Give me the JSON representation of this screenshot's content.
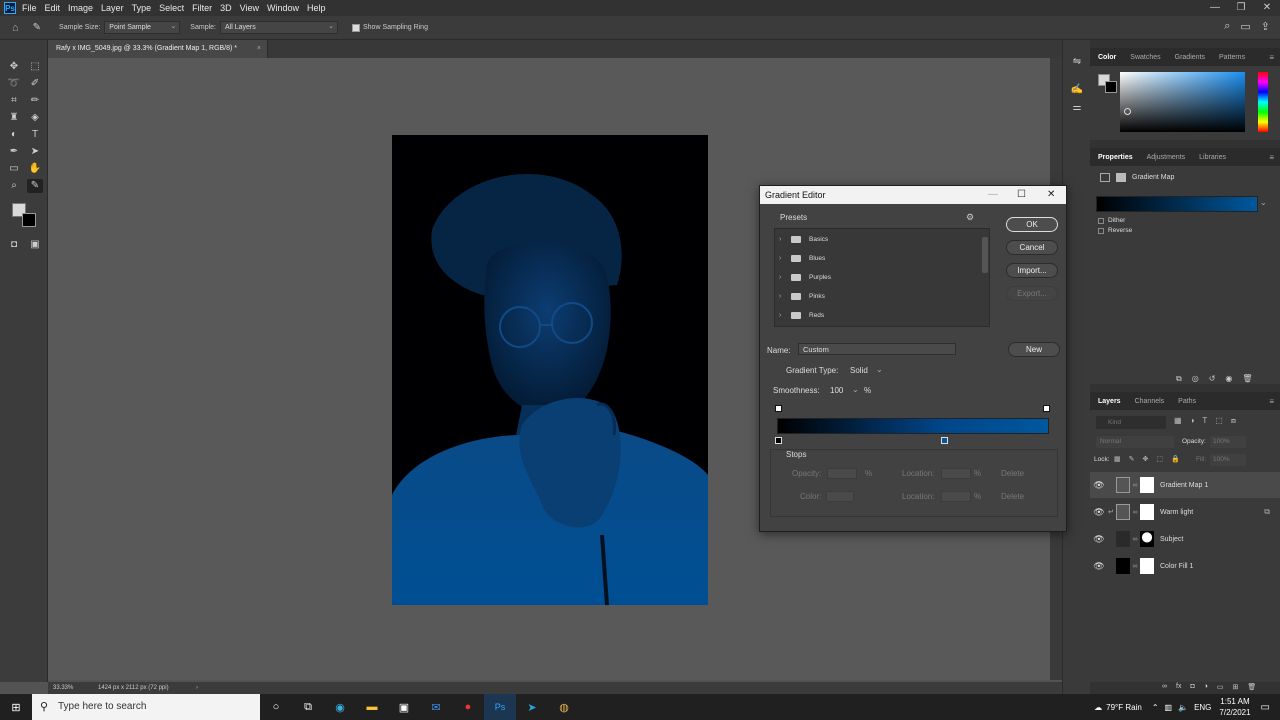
{
  "app": {
    "menu": [
      "File",
      "Edit",
      "Image",
      "Layer",
      "Type",
      "Select",
      "Filter",
      "3D",
      "View",
      "Window",
      "Help"
    ]
  },
  "options_bar": {
    "sample_size_label": "Sample Size:",
    "sample_size_value": "Point Sample",
    "sample_label": "Sample:",
    "sample_value": "All Layers",
    "sampling_ring_label": "Show Sampling Ring"
  },
  "document": {
    "tab_title": "Rafy x IMG_5049.jpg @ 33.3% (Gradient Map 1, RGB/8) *",
    "zoom": "33.33%",
    "dimensions": "1424 px x 2112 px (72 ppi)"
  },
  "color_panel": {
    "tabs": [
      "Color",
      "Swatches",
      "Gradients",
      "Patterns"
    ],
    "hue_color": "#1a8ff0"
  },
  "properties_panel": {
    "tabs": [
      "Properties",
      "Adjustments",
      "Libraries"
    ],
    "title": "Gradient Map",
    "dither_label": "Dither",
    "reverse_label": "Reverse"
  },
  "layers_panel": {
    "tabs": [
      "Layers",
      "Channels",
      "Paths"
    ],
    "kind_placeholder": "Kind",
    "blend_mode": "Normal",
    "opacity_label": "Opacity:",
    "opacity_value": "100%",
    "lock_label": "Lock:",
    "fill_label": "Fill:",
    "fill_value": "100%",
    "layers": [
      {
        "name": "Gradient Map 1",
        "selected": true
      },
      {
        "name": "Warm light",
        "selected": false
      },
      {
        "name": "Subject",
        "selected": false
      },
      {
        "name": "Color Fill 1",
        "selected": false
      }
    ]
  },
  "gradient_editor": {
    "title": "Gradient Editor",
    "presets_label": "Presets",
    "preset_folders": [
      "Basics",
      "Blues",
      "Purples",
      "Pinks",
      "Reds"
    ],
    "buttons": {
      "ok": "OK",
      "cancel": "Cancel",
      "import": "Import...",
      "export": "Export...",
      "new": "New",
      "delete": "Delete"
    },
    "name_label": "Name:",
    "name_value": "Custom",
    "gradient_type_label": "Gradient Type:",
    "gradient_type_value": "Solid",
    "smoothness_label": "Smoothness:",
    "smoothness_value": "100",
    "smoothness_unit": "%",
    "stops_label": "Stops",
    "opacity_label": "Opacity:",
    "color_label": "Color:",
    "location_label": "Location:",
    "percent": "%",
    "gradient_colors": [
      "#000000",
      "#00589e"
    ]
  },
  "taskbar": {
    "search_placeholder": "Type here to search",
    "weather": "79°F  Rain",
    "time": "1:51 AM",
    "date": "7/2/2021"
  }
}
